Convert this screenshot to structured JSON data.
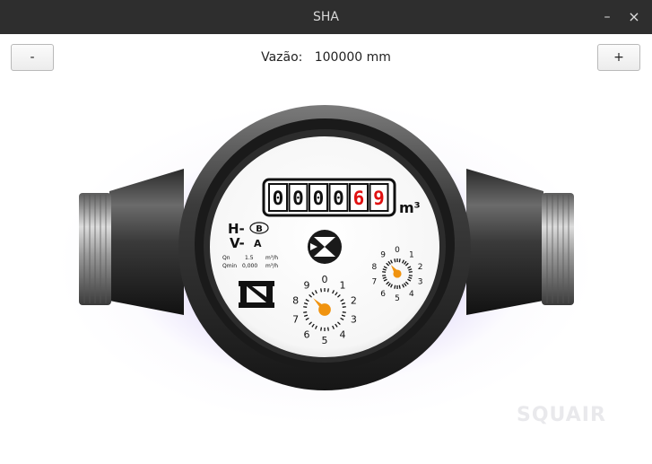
{
  "window": {
    "title": "SHA",
    "minimize_label": "–",
    "close_label": "×"
  },
  "controls": {
    "decrease_label": "-",
    "increase_label": "+"
  },
  "flow": {
    "label": "Vazão:",
    "value": "100000 mm"
  },
  "meter": {
    "odometer_digits": [
      "0",
      "0",
      "0",
      "0",
      "6",
      "9"
    ],
    "unit": "m³",
    "h_label": "H-",
    "h_class": "B",
    "v_label": "V-",
    "v_class": "A",
    "qn_label": "Qn",
    "qn_value": "1.5",
    "qn_unit": "m³/h",
    "qmin_label": "Qmin",
    "qmin_value": "0,000",
    "qmin_unit": "m³/h",
    "large_dial_numbers": [
      "0",
      "1",
      "2",
      "3",
      "4",
      "5",
      "6",
      "7",
      "8",
      "9"
    ],
    "small_dial_numbers": [
      "0",
      "1",
      "2",
      "3",
      "4",
      "5",
      "6",
      "7",
      "8",
      "9"
    ],
    "colors": {
      "pointer": "#f0930f",
      "red_digits": "#e01010",
      "glow": "#9a7fe6"
    }
  },
  "brand": {
    "watermark": "SQUAIR"
  }
}
